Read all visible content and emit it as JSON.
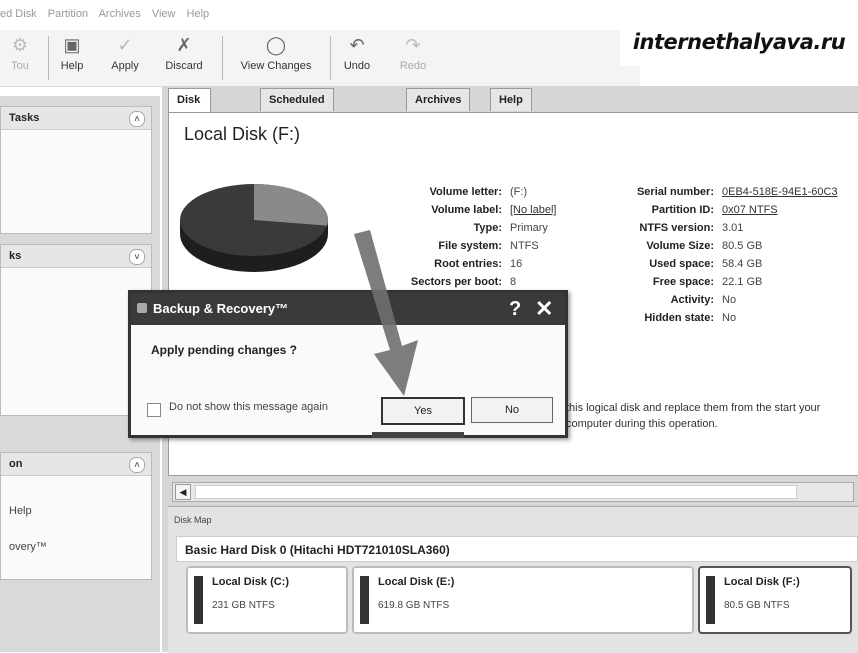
{
  "menubar": [
    "ed Disk",
    "Partition",
    "Archives",
    "View",
    "Help"
  ],
  "toolbar": {
    "items": [
      {
        "label": "Tou",
        "icon": "tool-icon"
      },
      {
        "label": "Help",
        "icon": "help-icon"
      },
      {
        "label": "Apply",
        "icon": "apply-icon"
      },
      {
        "label": "Discard",
        "icon": "discard-icon"
      },
      {
        "label": "View Changes",
        "icon": "view-changes-icon"
      },
      {
        "label": "Undo",
        "icon": "undo-icon"
      },
      {
        "label": "Redo",
        "icon": "redo-icon"
      }
    ]
  },
  "watermark": "internethalyava.ru",
  "sidebar": {
    "panels": [
      {
        "title": "Tasks",
        "items": []
      },
      {
        "title": "ks",
        "items": []
      },
      {
        "title": "on",
        "items": [
          "Help",
          "overy™"
        ]
      }
    ]
  },
  "tabs": [
    "Disk View",
    "Scheduled Tasks",
    "Archives",
    "Help"
  ],
  "disk": {
    "title": "Local Disk (F:)",
    "left_props": [
      {
        "label": "Volume letter:",
        "value": "(F:)"
      },
      {
        "label": "Volume label:",
        "value": "[No label]"
      },
      {
        "label": "Type:",
        "value": "Primary"
      },
      {
        "label": "File system:",
        "value": "NTFS"
      },
      {
        "label": "Root entries:",
        "value": "16"
      },
      {
        "label": "Sectors per boot:",
        "value": "8"
      }
    ],
    "right_props": [
      {
        "label": "Serial number:",
        "value": "0EB4-518E-94E1-60C3"
      },
      {
        "label": "Partition ID:",
        "value": "0x07 NTFS"
      },
      {
        "label": "NTFS version:",
        "value": "3.01"
      },
      {
        "label": "Volume Size:",
        "value": "80.5 GB"
      },
      {
        "label": "Used space:",
        "value": "58.4 GB"
      },
      {
        "label": "Free space:",
        "value": "22.1 GB"
      },
      {
        "label": "Activity:",
        "value": "No"
      },
      {
        "label": "Hidden state:",
        "value": "No"
      }
    ],
    "description": "this logical disk and replace them from the start your computer during this operation.",
    "used_fraction": 0.725
  },
  "diskmap": {
    "label": "Disk Map",
    "disk_name": "Basic Hard Disk 0 (Hitachi HDT721010SLA360)",
    "partitions": [
      {
        "name": "Local Disk (C:)",
        "info": "231 GB NTFS"
      },
      {
        "name": "Local Disk (E:)",
        "info": "619.8 GB NTFS"
      },
      {
        "name": "Local Disk (F:)",
        "info": "80.5 GB NTFS"
      }
    ]
  },
  "dialog": {
    "title": "Backup & Recovery™",
    "help_glyph": "?",
    "message": "Apply pending changes ?",
    "checkbox_label": "Do not show this message again",
    "yes_label": "Yes",
    "no_label": "No"
  },
  "colors": {
    "dialog_title_bg": "#3a3a3a",
    "arrow": "#6f6f6f"
  }
}
